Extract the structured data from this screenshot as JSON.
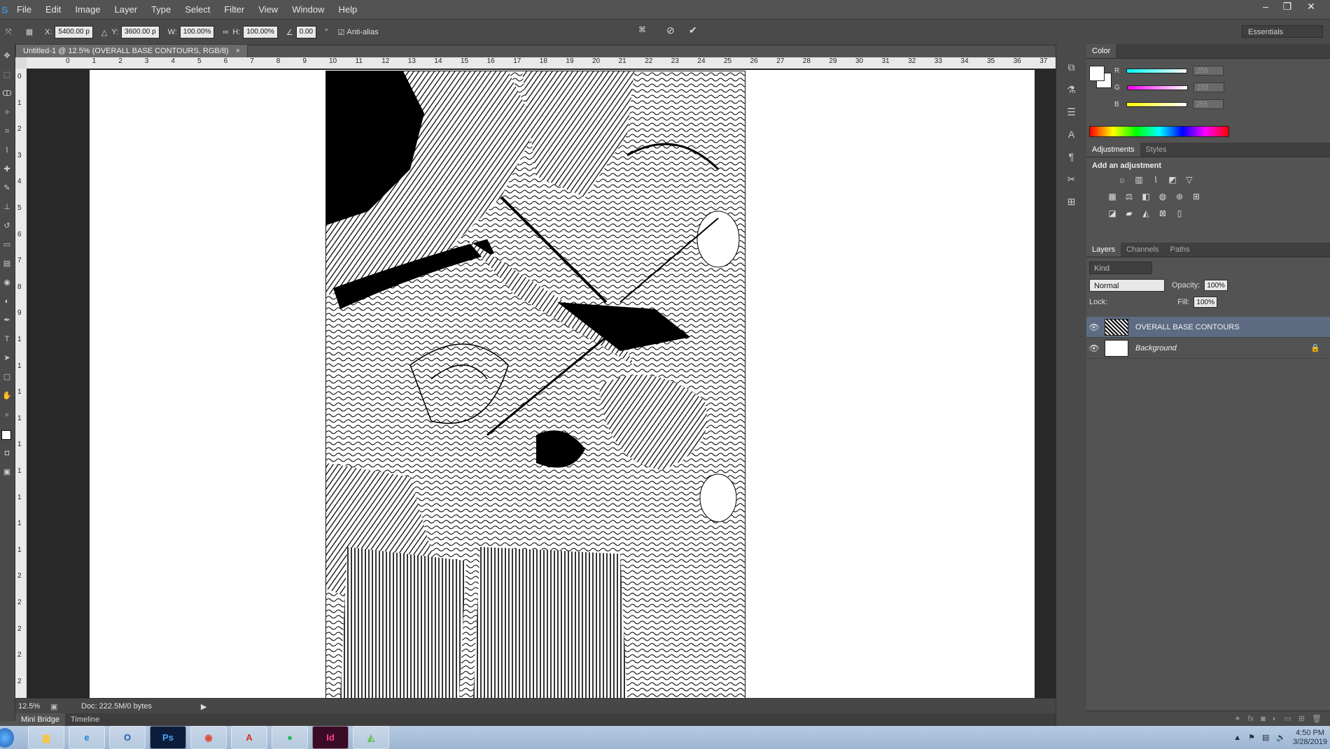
{
  "app": {
    "logo": "S"
  },
  "menu": [
    "File",
    "Edit",
    "Image",
    "Layer",
    "Type",
    "Select",
    "Filter",
    "View",
    "Window",
    "Help"
  ],
  "window_controls": {
    "minimize": "–",
    "restore": "❐",
    "close": "✕"
  },
  "options": {
    "x_label": "X:",
    "x_value": "5400.00 p",
    "y_label": "Y:",
    "y_value": "3600.00 p",
    "w_label": "W:",
    "w_value": "100.00%",
    "h_label": "H:",
    "h_value": "100.00%",
    "angle_value": "0.00",
    "angle_unit": "°",
    "antialias_label": "Anti-alias",
    "workspace": "Essentials"
  },
  "document": {
    "tab_title": "Untitled-1 @ 12.5% (OVERALL BASE CONTOURS, RGB/8)",
    "close": "×"
  },
  "ruler_h": [
    "0",
    "1",
    "2",
    "3",
    "4",
    "5",
    "6",
    "7",
    "8",
    "9",
    "10",
    "11",
    "12",
    "13",
    "14",
    "15",
    "16",
    "17",
    "18",
    "19",
    "20",
    "21",
    "22",
    "23",
    "24",
    "25",
    "26",
    "27",
    "28",
    "29",
    "30",
    "31",
    "32",
    "33",
    "34",
    "35",
    "36",
    "37"
  ],
  "ruler_v": [
    "0",
    "1",
    "2",
    "3",
    "4",
    "5",
    "6",
    "7",
    "8",
    "9",
    "1",
    "1",
    "1",
    "1",
    "1",
    "1",
    "1",
    "1",
    "1",
    "2",
    "2",
    "2",
    "2",
    "2"
  ],
  "status": {
    "zoom": "12.5%",
    "doc": "Doc: 222.5M/0 bytes"
  },
  "bottom_tabs": [
    "Mini Bridge",
    "Timeline"
  ],
  "color_panel": {
    "tab": "Color",
    "sliders": [
      {
        "label": "R",
        "value": "255",
        "gradient": "#00ffff"
      },
      {
        "label": "G",
        "value": "255",
        "gradient": "#ff00ff"
      },
      {
        "label": "B",
        "value": "255",
        "gradient": "#ffff00"
      }
    ]
  },
  "adjustments": {
    "tabs": [
      "Adjustments",
      "Styles"
    ],
    "title": "Add an adjustment"
  },
  "layers_panel": {
    "tabs": [
      "Layers",
      "Channels",
      "Paths"
    ],
    "kind": "Kind",
    "blend_mode": "Normal",
    "opacity_label": "Opacity:",
    "opacity": "100%",
    "lock_label": "Lock:",
    "fill_label": "Fill:",
    "fill": "100%",
    "layers": [
      {
        "name": "OVERALL BASE CONTOURS",
        "selected": true
      },
      {
        "name": "Background",
        "selected": false
      }
    ]
  },
  "taskbar": {
    "apps": [
      "Ps",
      "Id"
    ],
    "time": "4:50 PM",
    "date": "3/28/2019"
  }
}
